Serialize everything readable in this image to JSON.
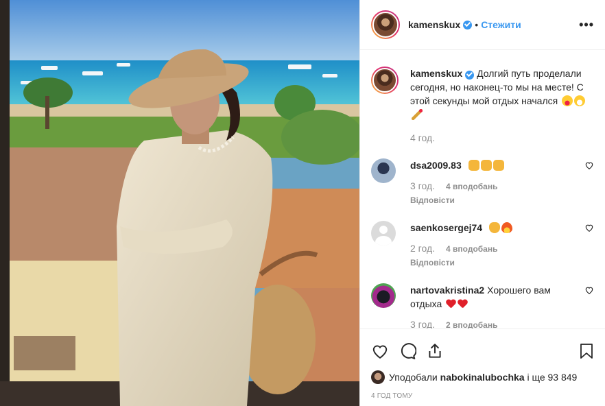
{
  "header": {
    "username": "kamenskux",
    "separator": "•",
    "follow_label": "Стежити",
    "more_label": "•••"
  },
  "caption": {
    "username": "kamenskux",
    "text": "Долгий путь проделали сегодня, но наконец-то мы на месте! С этой секунды мой отдых начался",
    "time": "4 год."
  },
  "comments": [
    {
      "username": "dsa2009.83",
      "text": "",
      "time": "3 год.",
      "likes": "4 вподобань",
      "reply": "Відповісти",
      "emoji": [
        "thumbs-up",
        "thumbs-up",
        "thumbs-up"
      ]
    },
    {
      "username": "saenkosergej74",
      "text": "",
      "time": "2 год.",
      "likes": "4 вподобань",
      "reply": "Відповісти",
      "emoji": [
        "clap",
        "fire"
      ]
    },
    {
      "username": "nartovakristina2",
      "text": "Хорошего вам отдыха",
      "time": "3 год.",
      "likes": "2 вподобань",
      "emoji": [
        "red-heart",
        "red-heart"
      ]
    }
  ],
  "likes": {
    "prefix": "Уподобали",
    "user": "nabokinalubochka",
    "suffix": "і ще 93 849"
  },
  "posted_ago": "4 ГОД ТОМУ",
  "colors": {
    "accent": "#3897f0",
    "muted": "#8e8e8e",
    "text": "#262626"
  }
}
